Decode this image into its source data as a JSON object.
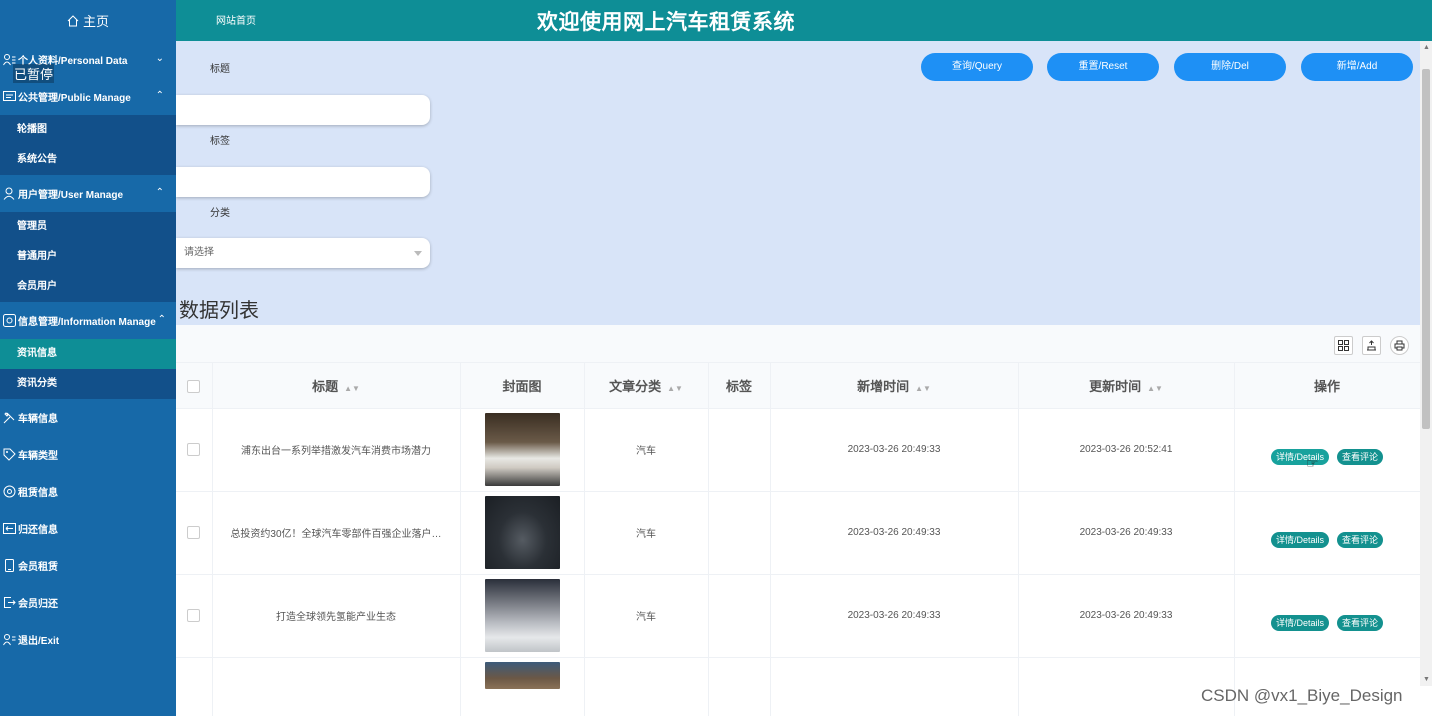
{
  "topbar": {
    "home_label": "主页",
    "site_link": "网站首页",
    "title": "欢迎使用网上汽车租赁系统"
  },
  "paused_label": "已暂停",
  "sidebar": {
    "personal": "个人资料/Personal Data",
    "public_manage": "公共管理/Public Manage",
    "public_items": [
      "轮播图",
      "系统公告"
    ],
    "user_manage": "用户管理/User Manage",
    "user_items": [
      "管理员",
      "普通用户",
      "会员用户"
    ],
    "info_manage": "信息管理/Information Manage",
    "info_items": [
      "资讯信息",
      "资讯分类"
    ],
    "car_info": "车辆信息",
    "car_type": "车辆类型",
    "rental_info": "租赁信息",
    "return_info": "归还信息",
    "member_rental": "会员租赁",
    "member_return": "会员归还",
    "exit": "退出/Exit"
  },
  "search": {
    "title_label": "标题",
    "tag_label": "标签",
    "category_label": "分类",
    "category_placeholder": "请选择"
  },
  "buttons": {
    "query": "查询/Query",
    "reset": "重置/Reset",
    "delete": "删除/Del",
    "add": "新增/Add"
  },
  "list_title": "数据列表",
  "table": {
    "headers": {
      "title": "标题",
      "cover": "封面图",
      "category": "文章分类",
      "tag": "标签",
      "created": "新增时间",
      "updated": "更新时间",
      "actions": "操作"
    },
    "rows": [
      {
        "title": "浦东出台一系列举措激发汽车消费市场潜力",
        "category": "汽车",
        "tag": "",
        "created": "2023-03-26 20:49:33",
        "updated": "2023-03-26 20:52:41"
      },
      {
        "title": "总投资约30亿！全球汽车零部件百强企业落户…",
        "category": "汽车",
        "tag": "",
        "created": "2023-03-26 20:49:33",
        "updated": "2023-03-26 20:49:33"
      },
      {
        "title": "打造全球领先氢能产业生态",
        "category": "汽车",
        "tag": "",
        "created": "2023-03-26 20:49:33",
        "updated": "2023-03-26 20:49:33"
      }
    ],
    "details_label": "详情/Details",
    "comments_label": "查看评论"
  },
  "watermark": "CSDN @vx1_Biye_Design",
  "colors": {
    "sidebar": "#1769a8",
    "submenu": "#12508a",
    "accent": "#0e8e96",
    "button": "#1e90f5",
    "search_bg": "#d8e4f8"
  }
}
